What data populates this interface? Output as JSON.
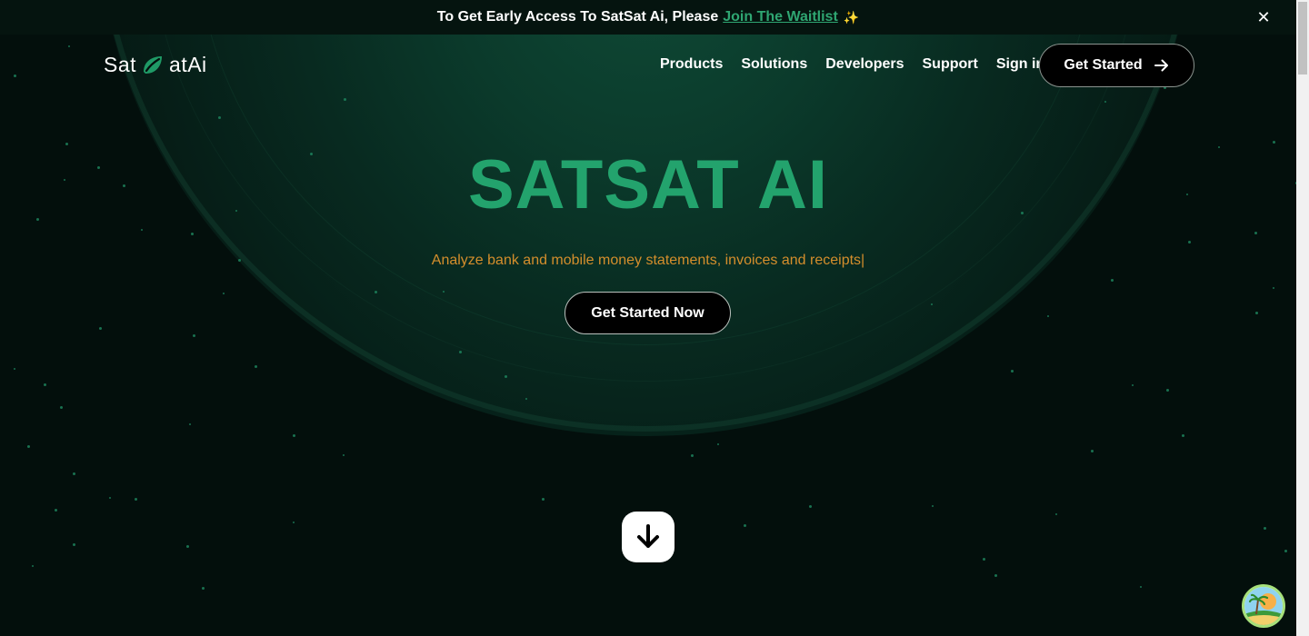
{
  "banner": {
    "text": "To Get Early Access To SatSat Ai, Please",
    "link_label": "Join The Waitlist",
    "sparkle": "✨",
    "close_label": "✕"
  },
  "nav": {
    "logo_left": "Sat",
    "logo_right": "atAi",
    "items": [
      {
        "label": "Products"
      },
      {
        "label": "Solutions"
      },
      {
        "label": "Developers"
      },
      {
        "label": "Support"
      },
      {
        "label": "Sign in"
      }
    ],
    "cta_label": "Get Started"
  },
  "hero": {
    "title": "SATSAT AI",
    "subtitle": "Analyze bank and mobile money statements, invoices and receipts|",
    "button_label": "Get Started Now"
  },
  "colors": {
    "accent": "#23a36d",
    "subtitle": "#d48e2c",
    "background": "#030f0c"
  },
  "icons": {
    "logo": "leaf-icon",
    "nav_cta": "arrow-right-icon",
    "scroll": "arrow-down-icon",
    "chat": "avatar-island-icon",
    "close": "close-icon"
  }
}
